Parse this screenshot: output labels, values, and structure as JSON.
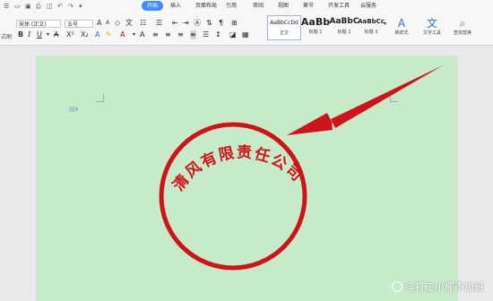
{
  "tabs": [
    "开始",
    "插入",
    "页面布局",
    "引用",
    "审阅",
    "视图",
    "章节",
    "开发工具",
    "云服务"
  ],
  "ribbon": {
    "left_labels": [
      "式刷"
    ],
    "font_name": "宋体 (正文)",
    "font_size": "五号",
    "styles": [
      {
        "sample": "AaBbCcDd",
        "name": "正文"
      },
      {
        "sample": "AaBb",
        "name": "标题 1"
      },
      {
        "sample": "AaBbC",
        "name": "标题 2"
      },
      {
        "sample": "AaBbCc",
        "name": "标题 3"
      }
    ],
    "tools": [
      {
        "icon": "A",
        "label": "新样式"
      },
      {
        "icon": "文",
        "label": "文字工具"
      },
      {
        "icon": "⌕",
        "label": "查找替换"
      }
    ]
  },
  "stamp": {
    "text": "清风有限责任公司",
    "color": "#d0131b"
  },
  "watermark": "@打工小椰不加班",
  "colors": {
    "page_bg": "#c6ebc9",
    "accent": "#3f8cff",
    "stamp_red": "#d0131b"
  }
}
